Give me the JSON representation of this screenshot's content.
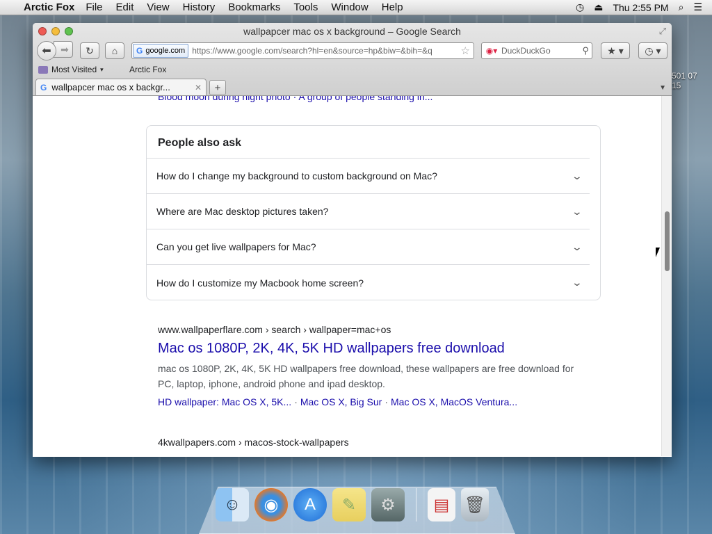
{
  "menubar": {
    "app_name": "Arctic Fox",
    "menus": [
      "File",
      "Edit",
      "View",
      "History",
      "Bookmarks",
      "Tools",
      "Window",
      "Help"
    ],
    "clock": "Thu 2:55 PM"
  },
  "window": {
    "title": "wallpapcer mac os x background – Google Search"
  },
  "navbar": {
    "site_identity": "google.com",
    "url": "https://www.google.com/search?hl=en&source=hp&biw=&bih=&q",
    "search_placeholder": "DuckDuckGo"
  },
  "bookmarks": {
    "most_visited": "Most Visited",
    "item": "Arctic Fox"
  },
  "tabs": [
    {
      "label": "wallpapcer mac os x backgr..."
    }
  ],
  "content": {
    "partial_top_links": "Blood moon during night photo · A group of people standing in...",
    "paa": {
      "title": "People also ask",
      "questions": [
        "How do I change my background to custom background on Mac?",
        "Where are Mac desktop pictures taken?",
        "Can you get live wallpapers for Mac?",
        "How do I customize my Macbook home screen?"
      ]
    },
    "result1": {
      "cite": "www.wallpaperflare.com › search › wallpaper=mac+os",
      "title": "Mac os 1080P, 2K, 4K, 5K HD wallpapers free download",
      "snippet": "mac os 1080P, 2K, 4K, 5K HD wallpapers free download, these wallpapers are free download for PC, laptop, iphone, android phone and ipad desktop.",
      "sublinks": [
        "HD wallpaper: Mac OS X, 5K...",
        "Mac OS X, Big Sur",
        "Mac OS X, MacOS Ventura..."
      ]
    },
    "result2": {
      "cite": "4kwallpapers.com › macos-stock-wallpapers"
    }
  },
  "desktop": {
    "side_text_1": "501 07",
    "side_text_2": "15"
  }
}
